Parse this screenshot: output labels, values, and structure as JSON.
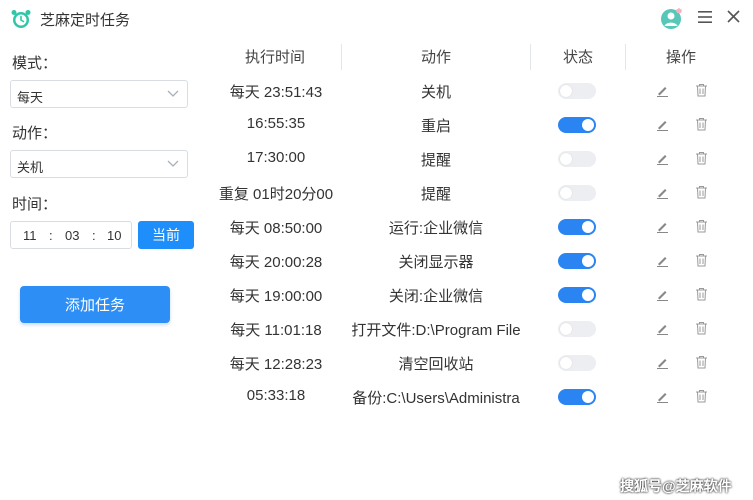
{
  "app": {
    "title": "芝麻定时任务",
    "accent": "#1e8ffa"
  },
  "form": {
    "mode_label": "模式：",
    "mode_value": "每天",
    "action_label": "动作：",
    "action_value": "关机",
    "time_label": "时间：",
    "time_hour": "11",
    "time_minute": "03",
    "time_second": "10",
    "now_button": "当前",
    "add_button": "添加任务"
  },
  "table": {
    "headers": [
      "执行时间",
      "动作",
      "状态",
      "操作"
    ],
    "rows": [
      {
        "time": "每天 23:51:43",
        "action": "关机",
        "enabled": false
      },
      {
        "time": "16:55:35",
        "action": "重启",
        "enabled": true
      },
      {
        "time": "17:30:00",
        "action": "提醒",
        "enabled": false
      },
      {
        "time": "重复 01时20分00",
        "action": "提醒",
        "enabled": false
      },
      {
        "time": "每天 08:50:00",
        "action": "运行:企业微信",
        "enabled": true
      },
      {
        "time": "每天 20:00:28",
        "action": "关闭显示器",
        "enabled": true
      },
      {
        "time": "每天 19:00:00",
        "action": "关闭:企业微信",
        "enabled": true
      },
      {
        "time": "每天 11:01:18",
        "action": "打开文件:D:\\Program  File",
        "enabled": false
      },
      {
        "time": "每天 12:28:23",
        "action": "清空回收站",
        "enabled": false
      },
      {
        "time": "05:33:18",
        "action": "备份:C:\\Users\\Administra",
        "enabled": true
      }
    ]
  },
  "watermark": "搜狐号@芝麻软件"
}
